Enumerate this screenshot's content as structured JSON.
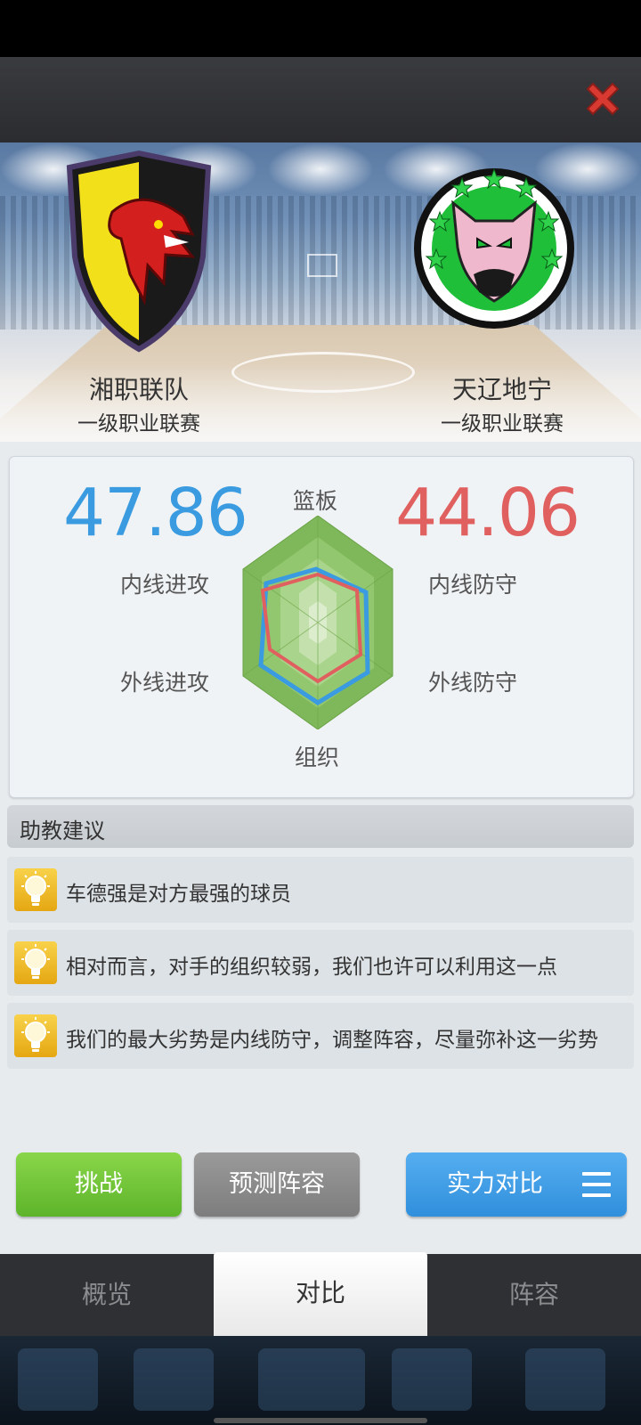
{
  "home_team": {
    "name": "湘职联队",
    "league": "一级职业联赛",
    "color": "#3a9be0",
    "logo": "dragon-shield-logo"
  },
  "away_team": {
    "name": "天辽地宁",
    "league": "一级职业联赛",
    "color": "#e06060",
    "logo": "wolf-star-logo"
  },
  "compare": {
    "home_score": "47.86",
    "away_score": "44.06",
    "axes": {
      "top": "篮板",
      "left_upper": "内线进攻",
      "left_lower": "外线进攻",
      "right_upper": "内线防守",
      "right_lower": "外线防守",
      "bottom": "组织"
    }
  },
  "advice": {
    "header": "助教建议",
    "items": [
      {
        "text": "车德强是对方最强的球员",
        "icon": "lightbulb-icon"
      },
      {
        "text": "相对而言，对手的组织较弱，我们也许可以利用这一点",
        "icon": "lightbulb-icon"
      },
      {
        "text": "我们的最大劣势是内线防守，调整阵容，尽量弥补这一劣势",
        "icon": "lightbulb-icon"
      }
    ]
  },
  "buttons": {
    "challenge": "挑战",
    "predict": "预测阵容",
    "strength": "实力对比"
  },
  "tabs": [
    {
      "label": "概览",
      "active": false
    },
    {
      "label": "对比",
      "active": true
    },
    {
      "label": "阵容",
      "active": false
    }
  ]
}
